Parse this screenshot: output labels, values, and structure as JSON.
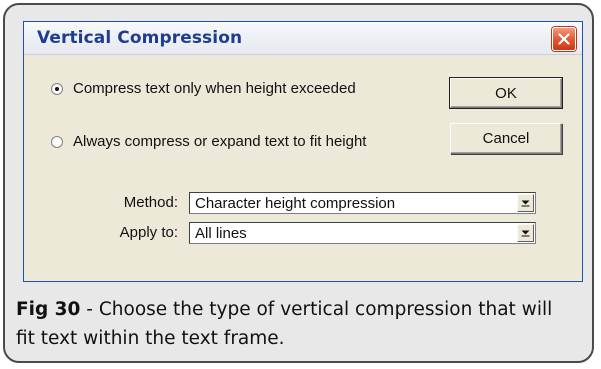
{
  "dialog": {
    "title": "Vertical Compression",
    "close_icon": "close-icon",
    "options": [
      {
        "label": "Compress text only when height exceeded",
        "selected": true
      },
      {
        "label": "Always compress or expand text to fit height",
        "selected": false
      }
    ],
    "ok_label": "OK",
    "cancel_label": "Cancel",
    "method": {
      "label": "Method:",
      "value": "Character height compression"
    },
    "apply_to": {
      "label": "Apply to:",
      "value": "All lines"
    }
  },
  "caption": {
    "fig_label": "Fig 30",
    "text": " - Choose the type of vertical compression that will fit text within the text frame."
  }
}
